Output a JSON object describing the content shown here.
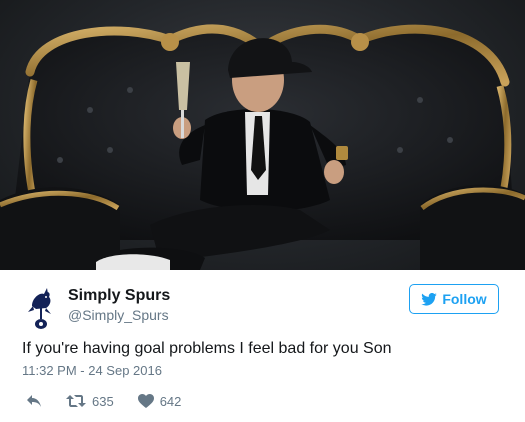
{
  "tweet": {
    "author_name": "Simply Spurs",
    "author_handle": "@Simply_Spurs",
    "follow_label": "Follow",
    "text": "If you're having goal problems I feel bad for you Son",
    "timestamp": "11:32 PM - 24 Sep 2016",
    "retweet_count": "635",
    "like_count": "642"
  },
  "icons": {
    "reply": "reply-icon",
    "retweet": "retweet-icon",
    "like": "heart-icon",
    "follow": "twitter-bird-icon",
    "avatar": "tottenham-cockerel-logo"
  },
  "colors": {
    "accent": "#1da1f2",
    "text": "#14171a",
    "muted": "#657786"
  }
}
